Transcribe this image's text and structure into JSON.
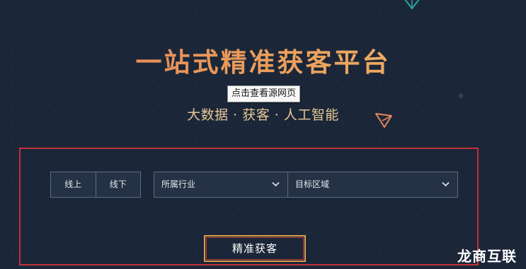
{
  "hero": {
    "title": "一站式精准获客平台",
    "subtitle": "大数据 · 获客 · 人工智能"
  },
  "tooltip": {
    "text": "点击查看源网页"
  },
  "filters": {
    "channels": [
      "线上",
      "线下"
    ],
    "industry_label": "所属行业",
    "region_label": "目标区域"
  },
  "actions": {
    "search_label": "精准获客"
  },
  "watermark": {
    "text": "龙商互联"
  },
  "colors": {
    "background": "#1b2738",
    "title_gradient_start": "#e27f57",
    "title_gradient_end": "#f0bb68",
    "subtitle": "#e7c796",
    "highlight_border": "#c4303a",
    "button_border": "#d79d47",
    "field_border": "#5d6b80",
    "deco_cyan": "#2aa6a0",
    "deco_orange": "#e8845a"
  },
  "icons": [
    "triangle-outline-icon",
    "paper-plane-icon",
    "chevron-down-icon"
  ]
}
